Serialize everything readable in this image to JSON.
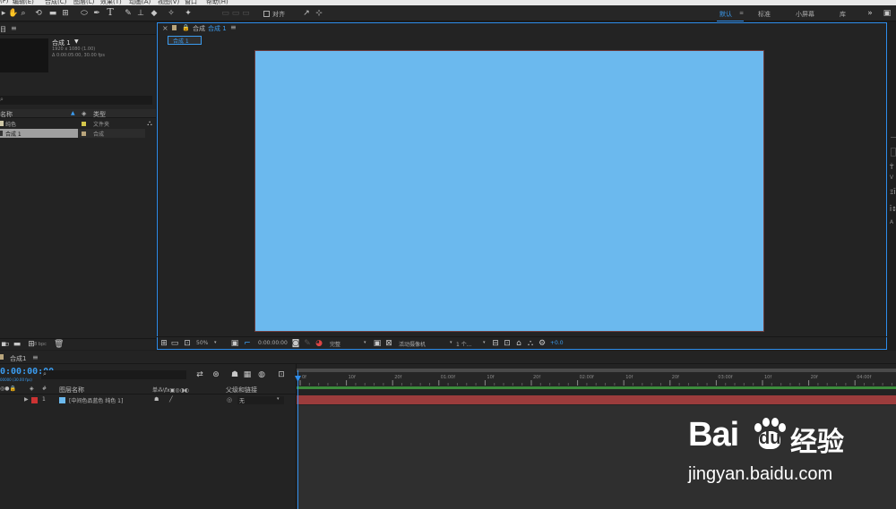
{
  "menu_bar": {
    "items": [
      "(F)",
      "编辑(E)",
      "合成(C)",
      "图层(L)",
      "效果(T)",
      "动画(A)",
      "视图(V)",
      "窗口",
      "帮助(H)"
    ]
  },
  "toolbar": {
    "snap_label": "对齐",
    "workspaces": [
      "默认",
      "标准",
      "小屏幕",
      "库"
    ],
    "menu_glyph": "≡"
  },
  "project_panel": {
    "title_fragment": "目",
    "comp_name": "合成 1",
    "comp_resolution": "1920 x 1080 (1.00)",
    "comp_duration": "Δ 0:00:05:00, 30.00 fps",
    "search_fragment": "⌕",
    "col_name": "名称",
    "col_type": "类型",
    "rows": [
      {
        "name": "纯色",
        "type": "文件夹",
        "color": "#d4c64a"
      },
      {
        "name": "合成 1",
        "type": "合成",
        "color": "#b9a57c"
      }
    ],
    "bpc": "8 bpc"
  },
  "comp_panel": {
    "close": "×",
    "title_prefix": "合成",
    "title_link": "合成 1",
    "tab_label": "合成 1",
    "canvas_color": "#6bb9ee",
    "zoom": "50%",
    "timecode": "0:00:00:00",
    "resolution": "完整",
    "camera": "活动摄像机",
    "views": "1 个...",
    "exposure": "+0.0"
  },
  "timeline_panel": {
    "tab_label": "合成1",
    "current_time": "0:00:00:00",
    "frame_info": "00000 (30.00 fps)",
    "search_icon_glyph": "⌕",
    "header": {
      "hash": "#",
      "layer_name": "图层名称",
      "switches": "单⁂\\fx▣◎◑◐",
      "parent": "父级和链接"
    },
    "layers": [
      {
        "index": "1",
        "name": "[中间色品蓝色 纯色 1]",
        "label_color": "#cc3333",
        "swatch_color": "#6bb9ee",
        "parent": "无"
      }
    ],
    "ruler": [
      "0f",
      "10f",
      "20f",
      "01:00f",
      "10f",
      "20f",
      "02:00f",
      "10f",
      "20f",
      "03:00f",
      "10f",
      "20f",
      "04:00f"
    ]
  },
  "right_panel": {
    "glyphs": [
      "Ť",
      "V",
      "ΞĪ",
      "Ī↕",
      "A"
    ]
  },
  "watermark": {
    "brand": "Bai",
    "brand2": "du",
    "chinese": "经验",
    "url": "jingyan.baidu.com"
  },
  "colors": {
    "accent": "#2d8ceb",
    "panel_bg": "#232323",
    "canvas": "#6bb9ee",
    "layer_bar": "#9c3c3c",
    "work_area_green": "#3c8c3c"
  }
}
